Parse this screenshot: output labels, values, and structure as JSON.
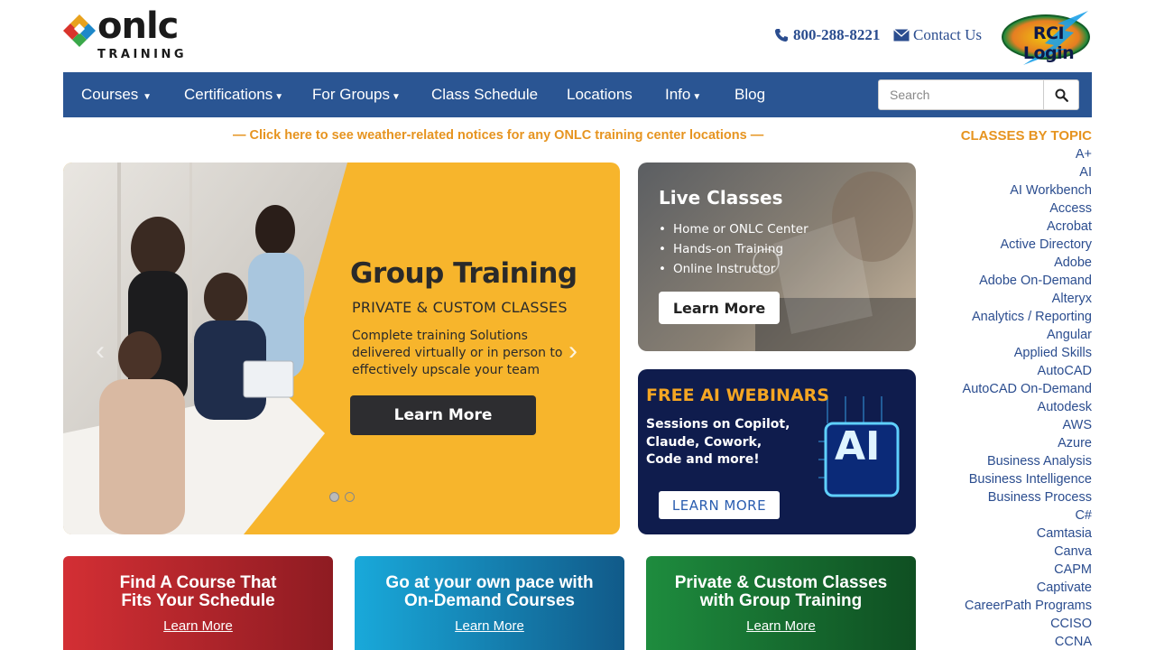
{
  "header": {
    "logo_word": "onlc",
    "logo_sub": "TRAINING",
    "phone": "800-288-8221",
    "contact": "Contact Us",
    "rci_login": "RCI Login"
  },
  "nav": {
    "items": [
      {
        "label": "Courses",
        "caret": true
      },
      {
        "label": "Certifications",
        "caret": true
      },
      {
        "label": "For Groups",
        "caret": true
      },
      {
        "label": "Class Schedule",
        "caret": false
      },
      {
        "label": "Locations",
        "caret": false
      },
      {
        "label": "Info",
        "caret": true
      },
      {
        "label": "Blog",
        "caret": false
      }
    ],
    "search_placeholder": "Search"
  },
  "notice": "— Click here to see weather-related notices for any ONLC training center locations —",
  "hero": {
    "title": "Group Training",
    "subtitle": "PRIVATE & CUSTOM CLASSES",
    "description": "Complete training Solutions delivered virtually or in person to effectively upscale your team",
    "button": "Learn More"
  },
  "live": {
    "title": "Live Classes",
    "bullets": [
      "Home or ONLC Center",
      "Hands-on Training",
      "Online Instructor"
    ],
    "button": "Learn More"
  },
  "ai": {
    "title": "FREE AI WEBINARS",
    "description": "Sessions on Copilot, Claude, Cowork, Code and more!",
    "button": "LEARN MORE",
    "chip_text": "AI"
  },
  "cards": [
    {
      "title": "Find A Course That Fits Your Schedule",
      "link": "Learn More"
    },
    {
      "title": "Go at your own pace with On-Demand Courses",
      "link": "Learn More"
    },
    {
      "title": "Private & Custom Classes with Group Training",
      "link": "Learn More"
    }
  ],
  "topics": {
    "heading": "CLASSES BY TOPIC",
    "items": [
      "A+",
      "AI",
      "AI Workbench",
      "Access",
      "Acrobat",
      "Active Directory",
      "Adobe",
      "Adobe On-Demand",
      "Alteryx",
      "Analytics / Reporting",
      "Angular",
      "Applied Skills",
      "AutoCAD",
      "AutoCAD On-Demand",
      "Autodesk",
      "AWS",
      "Azure",
      "Business Analysis",
      "Business Intelligence",
      "Business Process",
      "C#",
      "Camtasia",
      "Canva",
      "CAPM",
      "Captivate",
      "CareerPath Programs",
      "CCISO",
      "CCNA"
    ]
  },
  "colors": {
    "nav_bg": "#2a5593",
    "accent_orange": "#e69420",
    "link_blue": "#2b4d8f",
    "hero_yellow": "#f7b52c"
  },
  "icons": [
    "phone-icon",
    "mail-icon",
    "search-icon",
    "chevron-right-icon",
    "chevron-left-icon"
  ]
}
